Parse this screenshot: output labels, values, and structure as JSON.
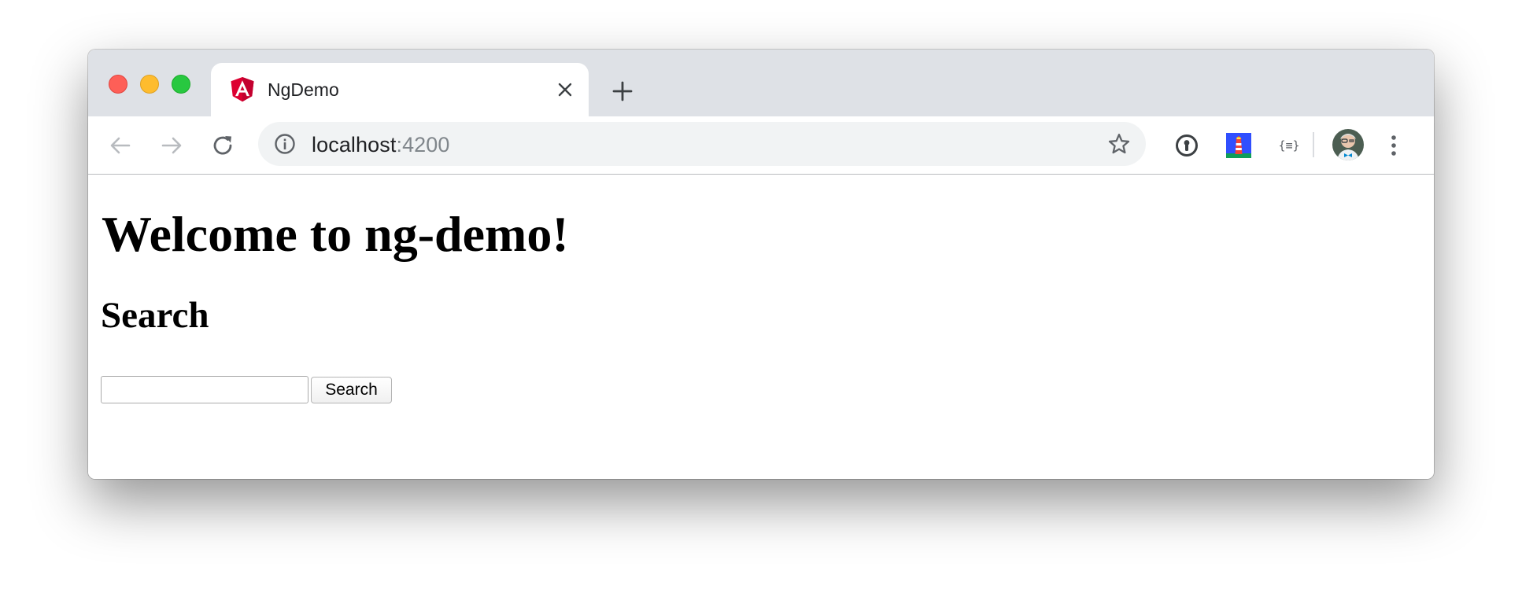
{
  "tab": {
    "title": "NgDemo",
    "favicon": "angular-logo-icon",
    "close_icon": "close-icon"
  },
  "toolbar": {
    "back_icon": "arrow-left-icon",
    "forward_icon": "arrow-right-icon",
    "reload_icon": "reload-icon",
    "info_icon": "info-icon",
    "bookmark_icon": "star-icon",
    "menu_icon": "vertical-dots-icon"
  },
  "omnibox": {
    "host": "localhost",
    "port": ":4200"
  },
  "extensions": {
    "password_manager_icon": "keyhole-icon",
    "lighthouse_icon": "lighthouse-icon",
    "json_viewer_label": "{≡}"
  },
  "page": {
    "heading": "Welcome to ng-demo!",
    "subheading": "Search",
    "search_input_value": "",
    "search_button_label": "Search"
  },
  "colors": {
    "traffic_red": "#fe5f57",
    "traffic_yellow": "#febc2e",
    "traffic_green": "#28c840",
    "angular_red": "#dd0031",
    "tabstrip_bg": "#dee1e6",
    "omnibox_bg": "#f1f3f4"
  }
}
